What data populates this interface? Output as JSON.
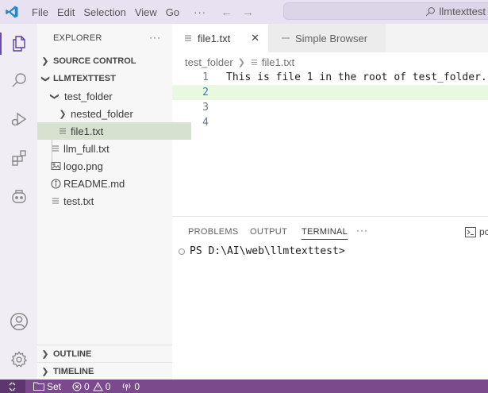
{
  "titlebar": {
    "menus": [
      "File",
      "Edit",
      "Selection",
      "View",
      "Go"
    ],
    "more": "···",
    "search": "llmtexttest"
  },
  "activitybar": {
    "items": [
      "explorer-icon",
      "search-icon",
      "run-debug-icon",
      "extensions-icon",
      "copilot-icon",
      "account-icon",
      "settings-gear-icon"
    ]
  },
  "sidebar": {
    "title": "EXPLORER",
    "more": "···",
    "sections": {
      "source_control": "SOURCE CONTROL",
      "workspace": "LLMTEXTTEST",
      "outline": "OUTLINE",
      "timeline": "TIMELINE"
    },
    "tree": {
      "test_folder": "test_folder",
      "nested_folder": "nested_folder",
      "file1": "file1.txt",
      "llm_full": "llm_full.txt",
      "logo": "logo.png",
      "readme": "README.md",
      "test": "test.txt"
    }
  },
  "editor": {
    "tabs": [
      {
        "label": "file1.txt",
        "close": "✕"
      },
      {
        "label": "Simple Browser"
      }
    ],
    "breadcrumb": [
      "test_folder",
      "file1.txt"
    ],
    "lines": [
      {
        "num": "1",
        "text": "This is file 1 in the root of test_folder."
      },
      {
        "num": "2",
        "text": ""
      },
      {
        "num": "3",
        "text": ""
      },
      {
        "num": "4",
        "text": ""
      }
    ]
  },
  "panel": {
    "tabs": [
      "PROBLEMS",
      "OUTPUT",
      "TERMINAL"
    ],
    "active_tab": "TERMINAL",
    "more": "···",
    "terminal_label": "pc",
    "prompt": "PS D:\\AI\\web\\llmtexttest>"
  },
  "statusbar": {
    "remote": "remote-icon",
    "folder_label": "Set",
    "errors": "0",
    "warnings": "0",
    "ports": "0"
  },
  "colors": {
    "titlebar": "#e8e1f1",
    "statusbar": "#7a4a8c",
    "selected_row": "#d7e1cf",
    "current_line": "#e9f8e0",
    "accent": "#6c4ab6"
  }
}
